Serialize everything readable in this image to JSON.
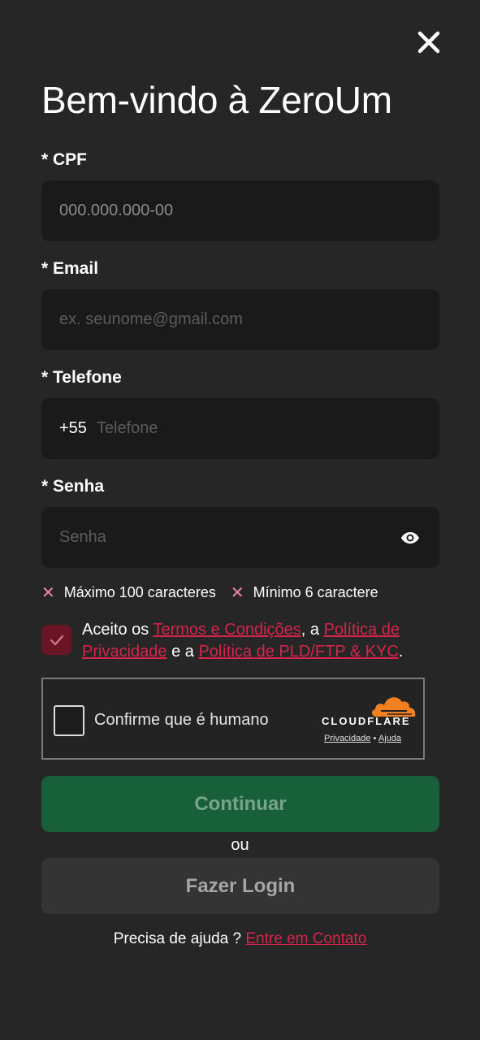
{
  "header": {
    "title": "Bem-vindo à ZeroUm",
    "close_icon": "close-icon"
  },
  "form": {
    "cpf": {
      "label": "* CPF",
      "placeholder": "000.000.000-00",
      "value": ""
    },
    "email": {
      "label": "* Email",
      "placeholder": "ex. seunome@gmail.com",
      "value": ""
    },
    "phone": {
      "label": "* Telefone",
      "prefix": "+55",
      "placeholder": "Telefone",
      "value": ""
    },
    "password": {
      "label": "* Senha",
      "placeholder": "Senha",
      "value": "",
      "toggle_icon": "eye-icon"
    },
    "rules": [
      {
        "text": "Máximo 100 caracteres",
        "status": "invalid"
      },
      {
        "text": "Mínimo 6 caractere",
        "status": "invalid"
      }
    ],
    "consent": {
      "checked": true,
      "prefix": "Aceito os ",
      "terms": "Termos e Condições",
      "sep1": ", a ",
      "privacy": "Política de Privacidade",
      "sep2": " e a ",
      "pld": "Política de PLD/FTP & KYC",
      "suffix": "."
    }
  },
  "captcha": {
    "label": "Confirme que é humano",
    "brand": "CLOUDFLARE",
    "privacy_link": "Privacidade",
    "separator": "•",
    "help_link": "Ajuda"
  },
  "actions": {
    "continue_label": "Continuar",
    "or_label": "ou",
    "login_label": "Fazer Login"
  },
  "footer": {
    "help_text": "Precisa de ajuda ? ",
    "contact_link": "Entre em Contato"
  },
  "colors": {
    "background": "#262626",
    "field_bg": "#1a1a1a",
    "accent_link": "#d6244a",
    "continue_bg": "#17603a",
    "login_bg": "#343434",
    "checkbox_bg": "#6b1426",
    "rule_x": "#f0879b",
    "cloudflare_orange": "#f38020"
  }
}
